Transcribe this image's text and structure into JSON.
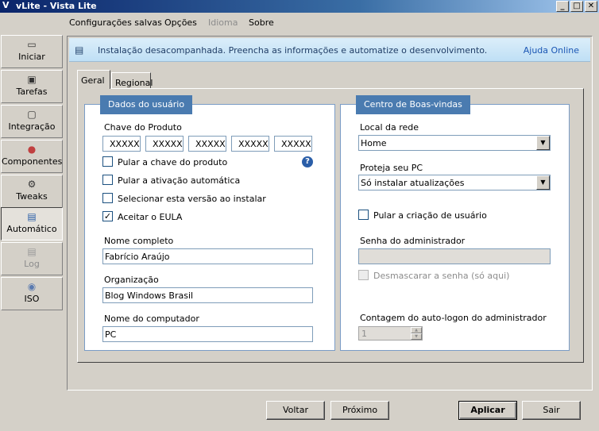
{
  "window": {
    "title": "vLite - Vista Lite",
    "app_icon": "V",
    "min": "_",
    "max": "□",
    "close": "✕"
  },
  "menu": [
    "Configurações salvas",
    "Opções",
    "Idioma",
    "Sobre"
  ],
  "sidebar": [
    {
      "label": "Iniciar",
      "icon": "window-icon"
    },
    {
      "label": "Tarefas",
      "icon": "tasks-icon"
    },
    {
      "label": "Integração",
      "icon": "disk-icon"
    },
    {
      "label": "Componentes",
      "icon": "components-icon"
    },
    {
      "label": "Tweaks",
      "icon": "gear-icon"
    },
    {
      "label": "Automático",
      "icon": "automatic-icon"
    },
    {
      "label": "Log",
      "icon": "log-icon"
    },
    {
      "label": "ISO",
      "icon": "cd-icon"
    }
  ],
  "banner": {
    "text": "Instalação desacompanhada. Preencha as informações e automatize o desenvolvimento.",
    "link": "Ajuda Online"
  },
  "tabs": [
    "Geral",
    "Regional"
  ],
  "user_data": {
    "title": "Dados do usuário",
    "product_key_label": "Chave do Produto",
    "product_key": [
      "XXXXX",
      "XXXXX",
      "XXXXX",
      "XXXXX",
      "XXXXX"
    ],
    "checkboxes": [
      {
        "label": "Pular a chave do produto",
        "checked": false
      },
      {
        "label": "Pular a ativação automática",
        "checked": false
      },
      {
        "label": "Selecionar esta versão ao instalar",
        "checked": false
      },
      {
        "label": "Aceitar o EULA",
        "checked": true
      }
    ],
    "full_name_label": "Nome completo",
    "full_name": "Fabrício Araújo",
    "org_label": "Organização",
    "org": "Blog Windows Brasil",
    "computer_label": "Nome do computador",
    "computer": "PC"
  },
  "welcome": {
    "title": "Centro de Boas-vindas",
    "network_label": "Local da rede",
    "network": "Home",
    "protect_label": "Proteja seu PC",
    "protect": "Só instalar atualizações",
    "skip_user_label": "Pular a criação de usuário",
    "admin_pw_label": "Senha do administrador",
    "admin_pw": "",
    "unmask_label": "Desmascarar a senha (só aqui)",
    "autologon_label": "Contagem do auto-logon do administrador",
    "autologon": "1"
  },
  "buttons": {
    "back": "Voltar",
    "next": "Próximo",
    "apply": "Aplicar",
    "exit": "Sair"
  },
  "check_mark": "✓",
  "help_mark": "?",
  "dropdown_arrow": "▼",
  "spin_up": "▲",
  "spin_down": "▼",
  "colors": {
    "title_start": "#0a246a",
    "group_title": "#4a7bb0",
    "banner": "#bfdff5",
    "link": "#1a56b4"
  }
}
